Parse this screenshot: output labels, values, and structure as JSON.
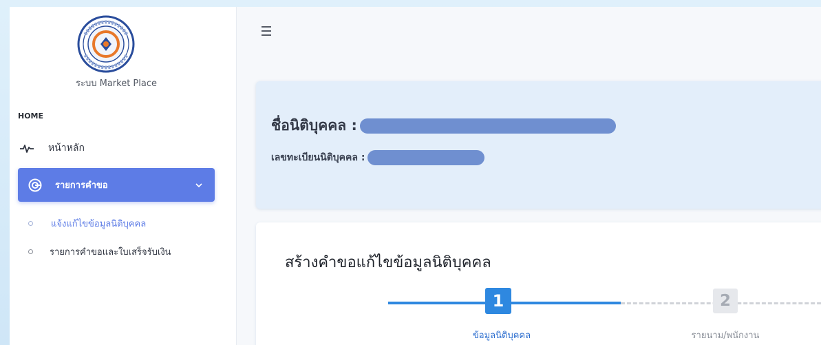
{
  "sidebar": {
    "system_name": "ระบบ Market Place",
    "section_home": "HOME",
    "home_label": "หน้าหลัก",
    "requests_label": "รายการคำขอ",
    "sub_items": [
      {
        "label": "แจ้งแก้ไขข้อมูลนิติบุคคล",
        "active": true
      },
      {
        "label": "รายการคำขอและใบเสร็จรับเงิน",
        "active": false
      }
    ]
  },
  "main": {
    "corp_name_label": "ชื่อนิติบุคคล :",
    "corp_reg_label": "เลขทะเบียนนิติบุคคล :",
    "form_title": "สร้างคำขอแก้ไขข้อมูลนิติบุคคล",
    "steps": [
      {
        "number": "1",
        "label": "ข้อมูลนิติบุคคล",
        "active": true
      },
      {
        "number": "2",
        "label": "รายนาม/พนักงาน",
        "active": false
      }
    ]
  },
  "colors": {
    "accent": "#5d7ce6",
    "step_active": "#2e88e0",
    "info_card_bg": "#e3eefa",
    "redaction": "#6f8fd0"
  },
  "icons": {
    "menu": "hamburger-icon",
    "home": "pulse-icon",
    "requests": "target-icon",
    "expand": "chevron-down-icon"
  }
}
